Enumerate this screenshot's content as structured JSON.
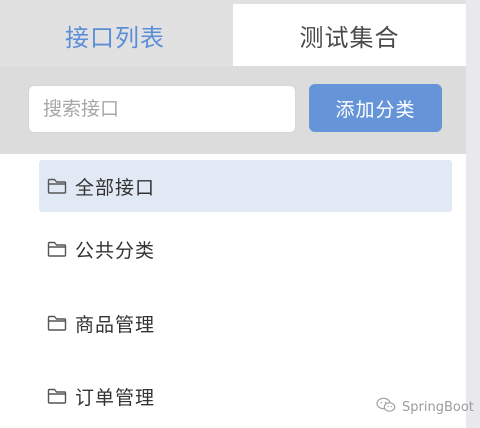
{
  "tabs": [
    {
      "label": "接口列表",
      "active": true
    },
    {
      "label": "测试集合",
      "active": false
    }
  ],
  "search": {
    "placeholder": "搜索接口",
    "value": ""
  },
  "toolbar": {
    "add_category_label": "添加分类"
  },
  "tree": {
    "items": [
      {
        "icon": "folder-icon",
        "label": "全部接口",
        "selected": true
      },
      {
        "icon": "folder-icon",
        "label": "公共分类",
        "selected": false
      },
      {
        "icon": "folder-icon",
        "label": "商品管理",
        "selected": false
      },
      {
        "icon": "folder-icon",
        "label": "订单管理",
        "selected": false
      }
    ]
  },
  "watermark": {
    "icon": "wechat-icon",
    "text": "SpringBoot"
  },
  "colors": {
    "accent": "#6594d9",
    "active_tab_text": "#5b8ed9",
    "selected_row": "#e1e9f5"
  }
}
